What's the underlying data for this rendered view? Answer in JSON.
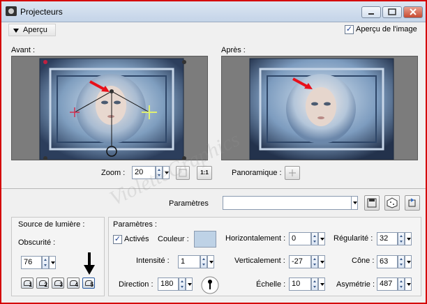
{
  "window": {
    "title": "Projecteurs"
  },
  "toolbar": {
    "preview_toggle_label": "Aperçu",
    "image_preview_label": "Aperçu de l'image",
    "image_preview_checked": true
  },
  "preview": {
    "before_label": "Avant :",
    "after_label": "Après :"
  },
  "zoom": {
    "label": "Zoom :",
    "value": "20",
    "one_to_one_label": "1:1"
  },
  "pan": {
    "label": "Panoramique :"
  },
  "presets": {
    "label": "Paramètres",
    "value": ""
  },
  "watermark": "VioletteGraphics",
  "light_source": {
    "title": "Source de lumière :",
    "darkness_label": "Obscurité :",
    "darkness_value": "76",
    "lights": [
      "1",
      "2",
      "3",
      "4",
      "5"
    ]
  },
  "params": {
    "title": "Paramètres :",
    "active_label": "Activés",
    "active_checked": true,
    "color_label": "Couleur :",
    "color_value": "#bed2e6",
    "intensity_label": "Intensité :",
    "intensity_value": "1",
    "direction_label": "Direction :",
    "direction_value": "180",
    "horizontal_label": "Horizontalement :",
    "horizontal_value": "0",
    "vertical_label": "Verticalement :",
    "vertical_value": "-27",
    "scale_label": "Échelle :",
    "scale_value": "10",
    "regularity_label": "Régularité :",
    "regularity_value": "32",
    "cone_label": "Cône :",
    "cone_value": "63",
    "asymmetry_label": "Asymétrie :",
    "asymmetry_value": "487"
  }
}
